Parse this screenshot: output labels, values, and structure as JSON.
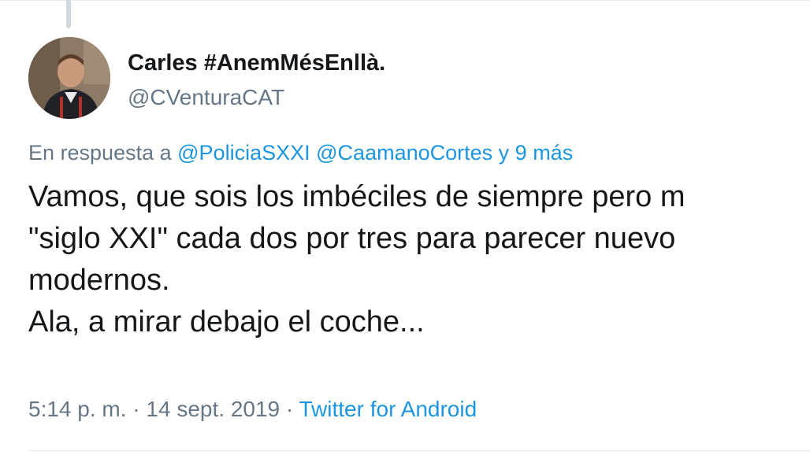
{
  "tweet": {
    "author": {
      "display_name": "Carles #AnemMésEnllà.",
      "handle": "@CVenturaCAT"
    },
    "reply_to": {
      "prefix": "En respuesta a",
      "mention_1": "@PoliciaSXXI",
      "mention_2": "@CaamanoCortes",
      "more": "y 9 más"
    },
    "body_lines": [
      "Vamos, que sois los imbéciles de siempre pero m",
      "\"siglo XXI\" cada dos por tres para parecer nuevo",
      "modernos.",
      "Ala, a mirar debajo el coche..."
    ],
    "meta": {
      "time": "5:14 p. m.",
      "separator": "·",
      "date": "14 sept. 2019",
      "source": "Twitter for Android"
    }
  },
  "colors": {
    "text_primary": "#14171a",
    "text_secondary": "#657786",
    "link": "#1b95e0",
    "divider": "#e6ecf0"
  },
  "icons": {
    "avatar": "user-avatar-photo"
  }
}
